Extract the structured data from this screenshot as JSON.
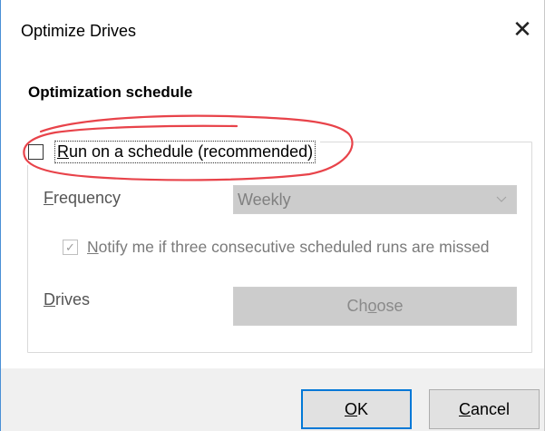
{
  "window": {
    "title": "Optimize Drives",
    "close_glyph": "✕"
  },
  "schedule": {
    "section_title": "Optimization schedule",
    "run_on_schedule": {
      "label_accel": "R",
      "label_rest": "un on a schedule (recommended)",
      "checked": false
    },
    "frequency": {
      "label_accel": "F",
      "label_rest": "requency",
      "value": "Weekly",
      "enabled": false
    },
    "notify": {
      "label_accel": "N",
      "label_rest": "otify me if three consecutive scheduled runs are missed",
      "checked": true,
      "enabled": false,
      "check_glyph": "✓"
    },
    "drives": {
      "label_accel": "D",
      "label_rest": "rives",
      "button_pre": "Ch",
      "button_accel": "o",
      "button_post": "ose",
      "enabled": false
    }
  },
  "footer": {
    "ok_accel": "O",
    "ok_rest": "K",
    "cancel_accel": "C",
    "cancel_rest": "ancel"
  },
  "colors": {
    "annotation": "#e8434a",
    "focus_border": "#0078d7",
    "disabled_fill": "#cccccc"
  }
}
